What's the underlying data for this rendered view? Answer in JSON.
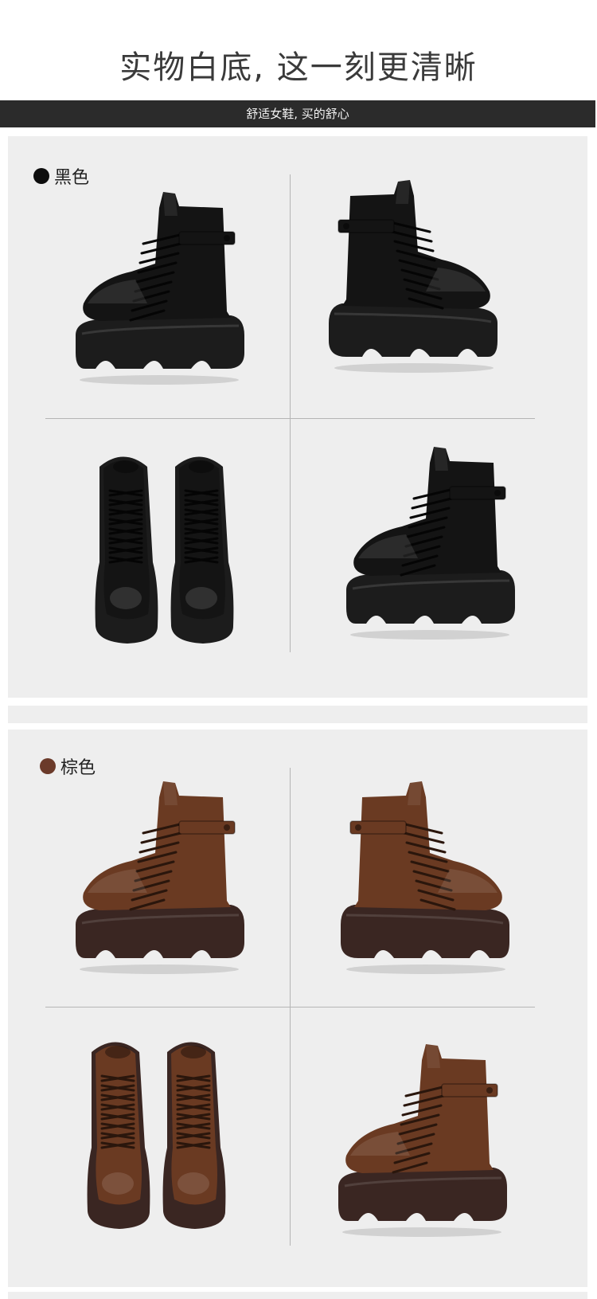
{
  "header": {
    "title": "实物白底, 这一刻更清晰"
  },
  "banner": {
    "text": "舒适女鞋, 买的舒心"
  },
  "sections": [
    {
      "label": "黑色",
      "swatch": "#0d0d0d",
      "upper": "#141414",
      "sole": "#1c1c1c",
      "lace": "#050505"
    },
    {
      "label": "棕色",
      "swatch": "#6b3a2a",
      "upper": "#6a3a22",
      "sole": "#3a2622",
      "lace": "#2a160c"
    }
  ]
}
